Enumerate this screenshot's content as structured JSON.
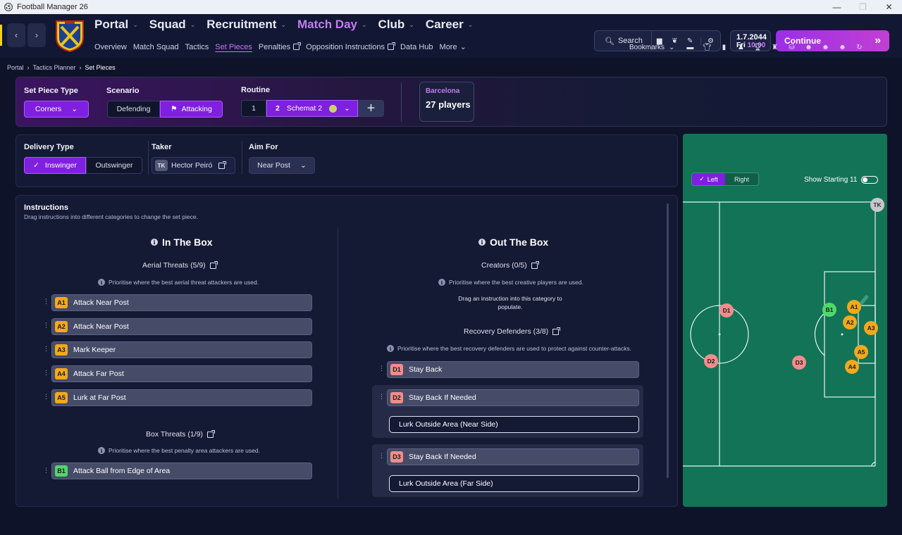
{
  "window": {
    "title": "Football Manager 26",
    "controls": [
      "—",
      "❐",
      "✕"
    ]
  },
  "nav": {
    "main": [
      {
        "label": "Portal",
        "active": false
      },
      {
        "label": "Squad",
        "active": false
      },
      {
        "label": "Recruitment",
        "active": false
      },
      {
        "label": "Match Day",
        "active": true
      },
      {
        "label": "Club",
        "active": false
      },
      {
        "label": "Career",
        "active": false
      }
    ],
    "sub": [
      {
        "label": "Overview",
        "ext": false,
        "active": false
      },
      {
        "label": "Match Squad",
        "ext": false,
        "active": false
      },
      {
        "label": "Tactics",
        "ext": false,
        "active": false
      },
      {
        "label": "Set Pieces",
        "ext": false,
        "active": true
      },
      {
        "label": "Penalties",
        "ext": true,
        "active": false
      },
      {
        "label": "Opposition Instructions",
        "ext": true,
        "active": false
      },
      {
        "label": "Data Hub",
        "ext": false,
        "active": false
      },
      {
        "label": "More",
        "ext": false,
        "active": false
      }
    ],
    "search_label": "Search",
    "date": "1.7.2044",
    "day": "Fri",
    "time": "10:00",
    "continue_label": "Continue",
    "bookmarks_label": "Bookmarks"
  },
  "breadcrumb": [
    "Portal",
    "Tactics Planner",
    "Set Pieces"
  ],
  "setpiece": {
    "type_label": "Set Piece Type",
    "type_value": "Corners",
    "scenario_label": "Scenario",
    "scenario_options": [
      "Defending",
      "Attacking"
    ],
    "scenario_selected": "Attacking",
    "routine_label": "Routine",
    "routine_1": "1",
    "routine_2": "2",
    "routine_name": "Schemat 2",
    "team_name": "Barcelona",
    "team_players": "27 players"
  },
  "delivery": {
    "type_label": "Delivery Type",
    "options": [
      "Inswinger",
      "Outswinger"
    ],
    "selected": "Inswinger",
    "taker_label": "Taker",
    "taker_badge": "TK",
    "taker_name": "Hector Peiró",
    "aim_label": "Aim For",
    "aim_value": "Near Post"
  },
  "instructions": {
    "title": "Instructions",
    "subtitle": "Drag instructions into different categories to change the set piece.",
    "in_box": {
      "heading": "In The Box",
      "aerial": {
        "title": "Aerial Threats (5/9)",
        "hint": "Prioritise where the best aerial threat attackers are used.",
        "items": [
          {
            "code": "A1",
            "label": "Attack Near Post"
          },
          {
            "code": "A2",
            "label": "Attack Near Post"
          },
          {
            "code": "A3",
            "label": "Mark Keeper"
          },
          {
            "code": "A4",
            "label": "Attack Far Post"
          },
          {
            "code": "A5",
            "label": "Lurk at Far Post"
          }
        ]
      },
      "box": {
        "title": "Box Threats (1/9)",
        "hint": "Prioritise where the best penalty area attackers are used.",
        "items": [
          {
            "code": "B1",
            "label": "Attack Ball from Edge of Area"
          }
        ]
      }
    },
    "out_box": {
      "heading": "Out The Box",
      "creators": {
        "title": "Creators (0/5)",
        "hint": "Prioritise where the best creative players are used.",
        "empty_line1": "Drag an instruction into this category to",
        "empty_line2": "populate."
      },
      "recovery": {
        "title": "Recovery Defenders (3/8)",
        "hint": "Prioritise where the best recovery defenders are used to protect against counter-attacks.",
        "items": [
          {
            "code": "D1",
            "label": "Stay Back"
          },
          {
            "code": "D2",
            "label": "Stay Back If Needed",
            "sub": "Lurk Outside Area (Near Side)"
          },
          {
            "code": "D3",
            "label": "Stay Back If Needed",
            "sub": "Lurk Outside Area (Far Side)"
          }
        ]
      }
    }
  },
  "pitch": {
    "side_options": [
      "Left",
      "Right"
    ],
    "side_selected": "Left",
    "show_starting_label": "Show Starting 11",
    "show_starting_on": false,
    "markers": [
      "TK",
      "D1",
      "D2",
      "D3",
      "B1",
      "A1",
      "A2",
      "A3",
      "A4",
      "A5"
    ]
  },
  "colors": {
    "accent": "#7f1fe0",
    "accent_text": "#c47cf0",
    "pitch": "#127356",
    "attacker": "#f2a91c",
    "box_threat": "#4fd86a",
    "defender": "#f28c8c"
  }
}
